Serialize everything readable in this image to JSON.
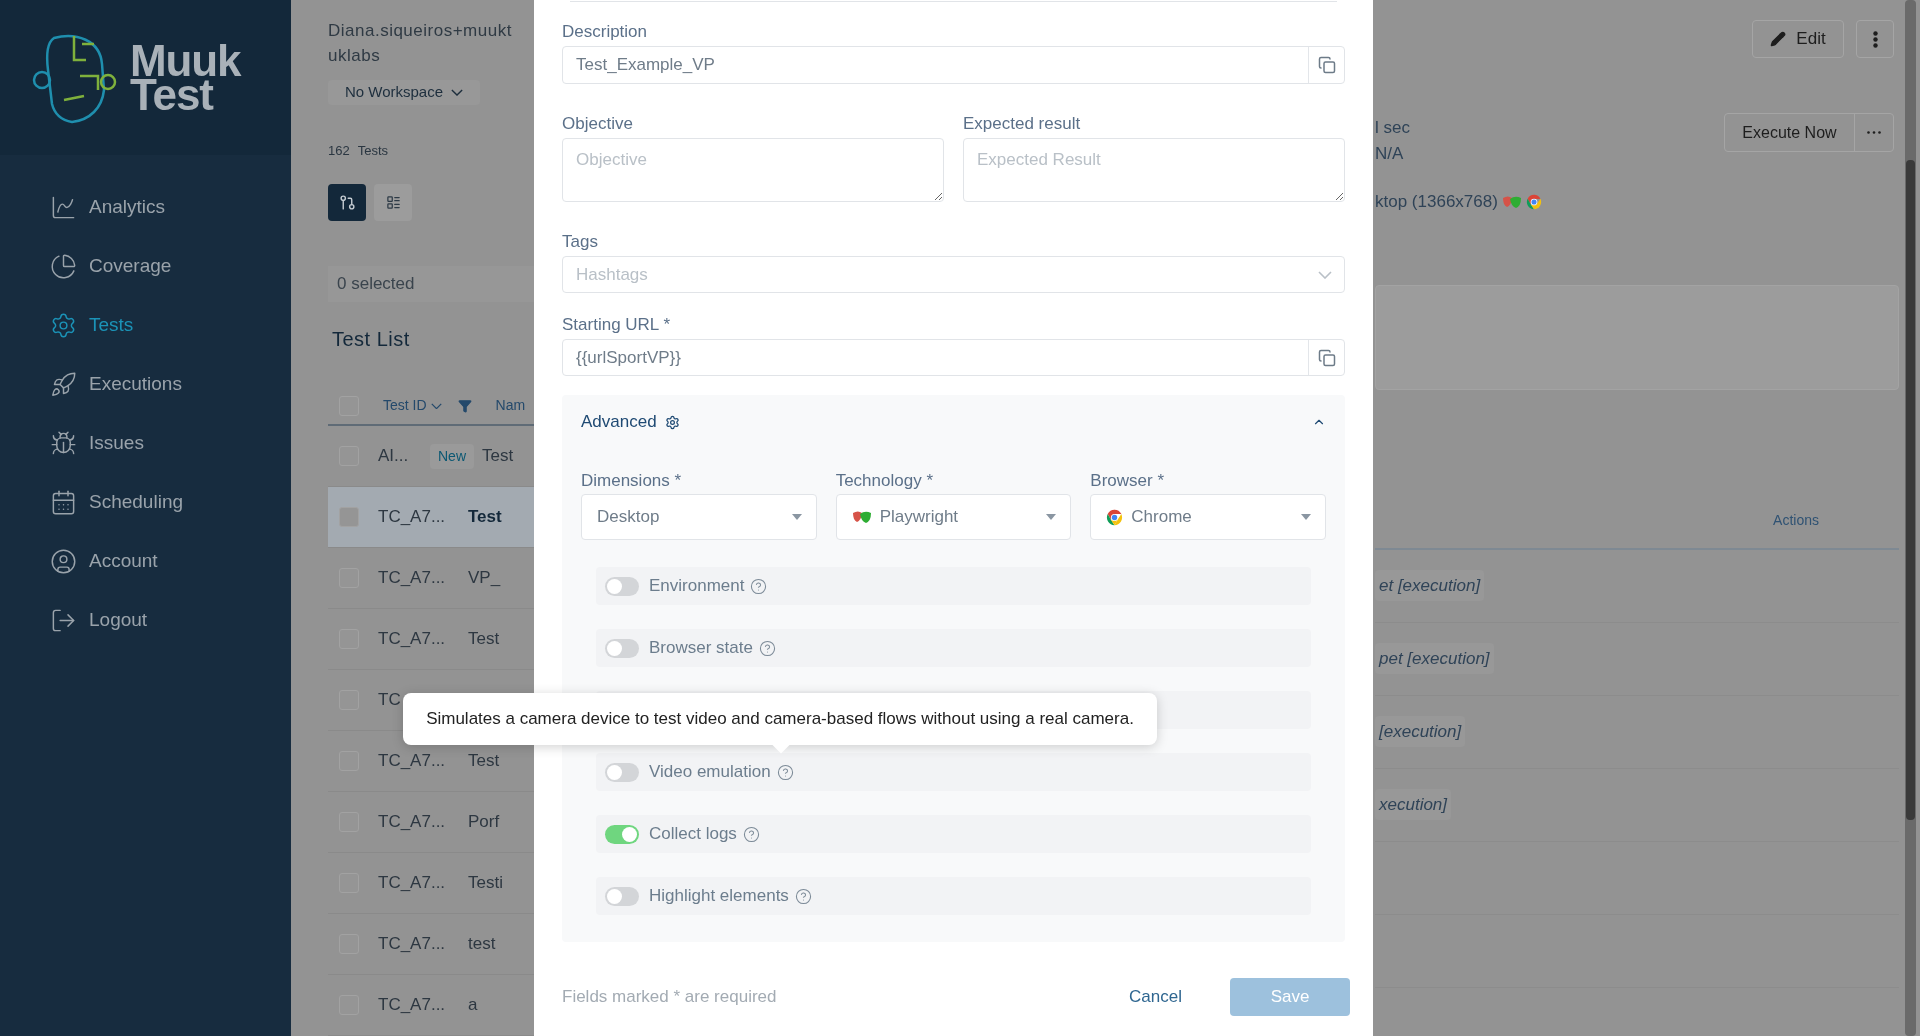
{
  "sidebar": {
    "logo": [
      "Muuk",
      "Test"
    ],
    "items": [
      {
        "label": "Analytics",
        "selected": false
      },
      {
        "label": "Coverage",
        "selected": false
      },
      {
        "label": "Tests",
        "selected": true
      },
      {
        "label": "Executions",
        "selected": false
      },
      {
        "label": "Issues",
        "selected": false
      },
      {
        "label": "Scheduling",
        "selected": false
      },
      {
        "label": "Account",
        "selected": false
      },
      {
        "label": "Logout",
        "selected": false
      }
    ]
  },
  "list_panel": {
    "user": [
      "Diana.siqueiros+muukt",
      "uklabs"
    ],
    "workspace": "No Workspace",
    "count": "162",
    "count_label": "Tests",
    "views": [
      {
        "selected": true
      },
      {
        "selected": false
      }
    ],
    "selection": "0 selected",
    "title": "Test List",
    "columns": [
      {
        "label": "Test ID",
        "kind": "sort"
      },
      {
        "label": "Nam",
        "kind": "plain"
      }
    ],
    "header_checked": false,
    "rows": [
      {
        "id": "AI...",
        "badge": "New",
        "name": "Test",
        "checked": false,
        "selected": false
      },
      {
        "id": "TC_A7...",
        "name": "Test",
        "checked": false,
        "selected": true
      },
      {
        "id": "TC_A7...",
        "name": "VP_",
        "checked": false,
        "selected": false
      },
      {
        "id": "TC_A7...",
        "name": "Test",
        "checked": false,
        "selected": false
      },
      {
        "id": "TC",
        "checked": false,
        "selected": false
      },
      {
        "id": "TC_A7...",
        "name": "Test",
        "checked": false,
        "selected": false
      },
      {
        "id": "TC_A7...",
        "name": "Porf",
        "checked": false,
        "selected": false
      },
      {
        "id": "TC_A7...",
        "name": "Testi",
        "checked": false,
        "selected": false
      },
      {
        "id": "TC_A7...",
        "name": "test",
        "checked": false,
        "selected": false
      },
      {
        "id": "TC_A7...",
        "name": "a",
        "checked": false,
        "selected": false
      }
    ]
  },
  "dialog": {
    "description": {
      "label": "Description",
      "value": "Test_Example_VP"
    },
    "objective": {
      "label": "Objective",
      "placeholder": "Objective"
    },
    "expected": {
      "label": "Expected result",
      "placeholder": "Expected Result"
    },
    "tags": {
      "label": "Tags",
      "placeholder": "Hashtags"
    },
    "starting_url": {
      "label": "Starting URL *",
      "value": "{{urlSportVP}}"
    },
    "advanced": {
      "title": "Advanced",
      "expanded": true,
      "selects": [
        {
          "label": "Dimensions *",
          "value": "Desktop"
        },
        {
          "label": "Technology *",
          "value": "Playwright"
        },
        {
          "label": "Browser *",
          "value": "Chrome"
        }
      ],
      "options": [
        {
          "kind": "toggle",
          "label": "Environment",
          "on": false
        },
        {
          "kind": "toggle",
          "label": "Browser state",
          "on": false
        },
        {
          "kind": "covered"
        },
        {
          "kind": "toggle",
          "label": "Video emulation",
          "on": false
        },
        {
          "kind": "toggle",
          "label": "Collect logs",
          "on": true
        },
        {
          "kind": "toggle",
          "label": "Highlight elements",
          "on": false
        }
      ]
    },
    "required_note": "Fields marked * are required",
    "cancel": "Cancel",
    "save": "Save"
  },
  "tooltip": "Simulates a camera device to test video and camera-based flows without using a real camera.",
  "detail_panel": {
    "edit": "Edit",
    "execute": "Execute Now",
    "info": [
      "l sec",
      "N/A"
    ],
    "device": "ktop (1366x768)",
    "actions_header": "Actions",
    "steps": [
      "et [execution]",
      "pet [execution]",
      "[execution]",
      "xecution]"
    ]
  }
}
